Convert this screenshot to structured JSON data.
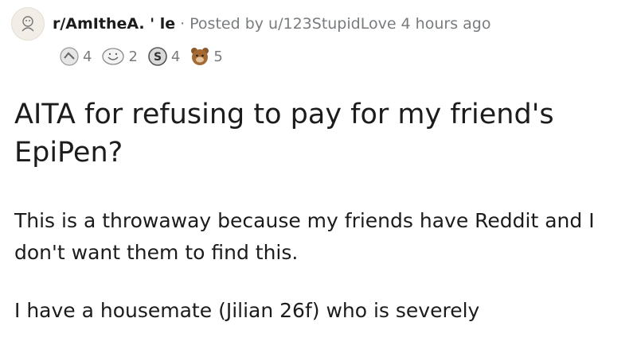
{
  "post": {
    "subreddit": "r/AmItheA.  '  le",
    "separator": "·",
    "posted_by": "Posted by u/123StupidLove 4 hours ago",
    "awards": [
      {
        "icon": "silver-award-icon",
        "count": "4"
      },
      {
        "icon": "wholesome-award-icon",
        "count": "2"
      },
      {
        "icon": "coin-award-icon",
        "count": "4"
      },
      {
        "icon": "bear-award-icon",
        "count": "5"
      }
    ],
    "title": "AITA for refusing to pay for my friend's EpiPen?",
    "body": [
      "This is a throwaway because my friends have Reddit and I don't want them to find this.",
      "I have a housemate (Jilian 26f) who is severely"
    ]
  }
}
